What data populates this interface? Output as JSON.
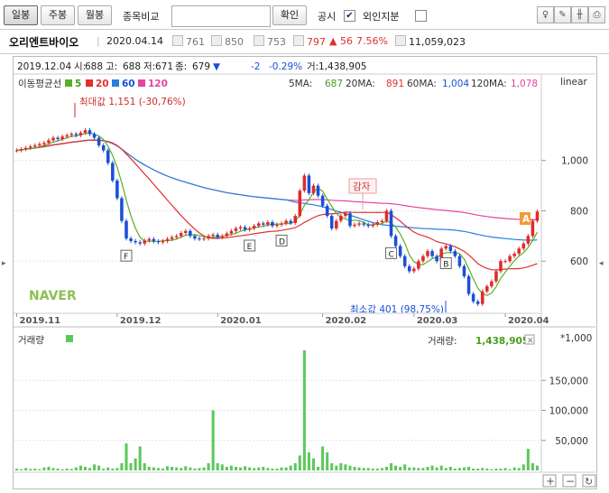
{
  "toolbar": {
    "daily_label": "일봉",
    "weekly_label": "주봉",
    "monthly_label": "월봉",
    "compare_label": "종목비교",
    "compare_placeholder": "",
    "confirm_label": "확인",
    "disclosure_label": "공시",
    "disclosure_checked": true,
    "foreign_label": "외인지분",
    "foreign_checked": false
  },
  "info": {
    "name": "오리엔트바이오",
    "date": "2020.04.14",
    "open": "761",
    "high": "850",
    "low": "753",
    "close": "797",
    "change": "▲ 56",
    "change_pct": "7.56%",
    "volume": "11,059,023"
  },
  "price_header": {
    "date": "2019.12.04",
    "open_label": "시:",
    "open": "688",
    "high_label": "고:",
    "high": "688",
    "low_label": "저:",
    "low": "671",
    "close_label": "종:",
    "close": "679",
    "arrow": "▼",
    "change": "-2",
    "change_pct": "-0.29%",
    "vol_label": "거:",
    "volume": "1,438,905"
  },
  "ma_legend": {
    "title": "이동평균선",
    "items": [
      {
        "label": "5",
        "color": "#5cae2a"
      },
      {
        "label": "20",
        "color": "#e03030"
      },
      {
        "label": "60",
        "color": "#2a7ee0"
      },
      {
        "label": "120",
        "color": "#e0479e"
      }
    ],
    "values": [
      {
        "label": "5MA:",
        "value": "687",
        "color": "#4a9c1a"
      },
      {
        "label": "20MA:",
        "value": "891",
        "color": "#e03030"
      },
      {
        "label": "60MA:",
        "value": "1,004",
        "color": "#1a4fd8"
      },
      {
        "label": "120MA:",
        "value": "1,078",
        "color": "#e0479e"
      }
    ],
    "scale": "linear"
  },
  "annotations": {
    "max_label": "최대값 1,151 (-30,76%)",
    "min_label": "최소값 401 (98,75%)",
    "capital_reduction": "감자",
    "a_marker": "A",
    "letters": [
      "F",
      "E",
      "D",
      "C",
      "B"
    ],
    "watermark": "NAVER"
  },
  "volume_panel": {
    "title": "거래량",
    "legend_color": "#5cc85c",
    "value_label": "거래량:",
    "value": "1,438,905",
    "unit": "*1,000"
  },
  "chart_data": [
    {
      "type": "candlestick",
      "title": "",
      "y_scale": "linear",
      "ylim": [
        400,
        1250
      ],
      "y_ticks": [
        600,
        800,
        1000
      ],
      "y_tick_labels": [
        "600",
        "800",
        "1,000"
      ],
      "x_tick_labels": [
        "2019.11",
        "2019.12",
        "2020.01",
        "2020.02",
        "2020.03",
        "2020.04"
      ],
      "grid": true,
      "series": [
        {
          "name": "5",
          "color": "#5cae2a"
        },
        {
          "name": "20",
          "color": "#e03030"
        },
        {
          "name": "60",
          "color": "#2a7ee0"
        },
        {
          "name": "120",
          "color": "#e0479e"
        }
      ],
      "close": [
        1040,
        1045,
        1050,
        1055,
        1060,
        1065,
        1070,
        1080,
        1090,
        1085,
        1095,
        1100,
        1105,
        1100,
        1110,
        1120,
        1105,
        1090,
        1060,
        1040,
        990,
        920,
        850,
        760,
        690,
        680,
        675,
        670,
        682,
        688,
        679,
        675,
        680,
        688,
        695,
        700,
        712,
        720,
        700,
        690,
        688,
        690,
        700,
        705,
        695,
        700,
        710,
        720,
        730,
        735,
        725,
        730,
        740,
        750,
        745,
        755,
        740,
        745,
        750,
        760,
        752,
        780,
        880,
        940,
        870,
        900,
        860,
        820,
        780,
        730,
        760,
        780,
        790,
        740,
        745,
        750,
        745,
        740,
        745,
        755,
        760,
        800,
        700,
        660,
        620,
        580,
        560,
        570,
        600,
        620,
        640,
        620,
        600,
        650,
        660,
        640,
        620,
        580,
        540,
        470,
        440,
        430,
        480,
        500,
        520,
        560,
        600,
        600,
        620,
        630,
        650,
        670,
        700,
        760,
        797
      ],
      "max": {
        "value": 1151,
        "pct": "-30,76%"
      },
      "min": {
        "value": 401,
        "pct": "98,75%"
      }
    },
    {
      "type": "bar",
      "title": "",
      "ylabel": "거래량",
      "unit": "*1,000",
      "ylim": [
        0,
        200000
      ],
      "y_ticks": [
        50000,
        100000,
        150000
      ],
      "y_tick_labels": [
        "50,000",
        "100,000",
        "150,000"
      ],
      "values": [
        3000,
        2000,
        4000,
        2500,
        3000,
        2000,
        5000,
        6000,
        4000,
        3000,
        2000,
        3000,
        2500,
        5000,
        8000,
        6000,
        4000,
        10000,
        8000,
        3000,
        5000,
        3000,
        4000,
        12000,
        45000,
        12000,
        20000,
        40000,
        12000,
        6000,
        5000,
        4000,
        3000,
        7000,
        6000,
        5000,
        4000,
        7000,
        5000,
        3000,
        4000,
        5000,
        12000,
        100000,
        12000,
        10000,
        6000,
        8000,
        6000,
        5000,
        7000,
        5000,
        4000,
        5000,
        6000,
        4000,
        3000,
        3000,
        5000,
        5000,
        8000,
        12000,
        25000,
        200000,
        30000,
        20000,
        6000,
        40000,
        30000,
        12000,
        8000,
        12000,
        10000,
        8000,
        6000,
        5000,
        4000,
        4000,
        3000,
        3000,
        4000,
        6000,
        12000,
        8000,
        6000,
        10000,
        5000,
        5000,
        4000,
        4000,
        6000,
        8000,
        5000,
        8000,
        4000,
        6000,
        3000,
        4000,
        5000,
        6000,
        3000,
        3000,
        4000,
        3000,
        2000,
        3000,
        3000,
        4000,
        2000,
        5000,
        4000,
        10000,
        36000,
        12000,
        8000
      ]
    }
  ]
}
